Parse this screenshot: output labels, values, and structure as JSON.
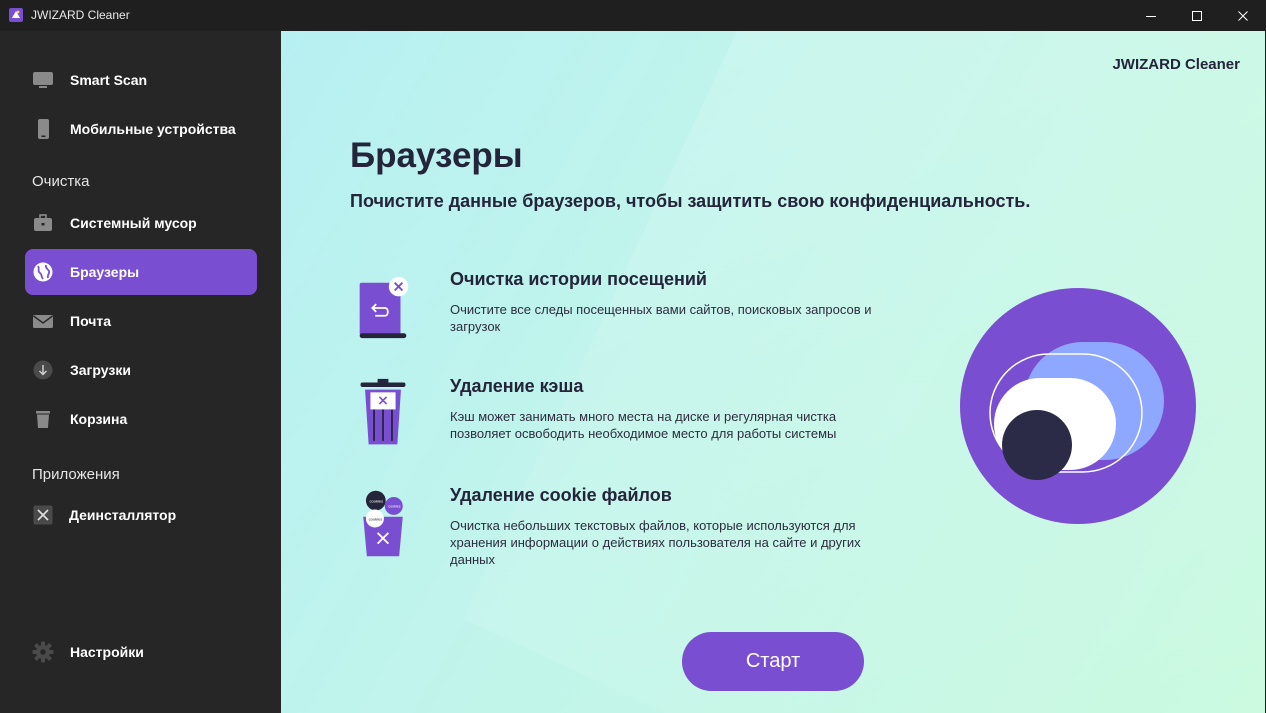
{
  "window": {
    "title": "JWIZARD Cleaner"
  },
  "sidebar": {
    "top_items": [
      {
        "label": "Smart Scan",
        "icon": "monitor-icon"
      },
      {
        "label": "Мобильные устройства",
        "icon": "phone-icon"
      }
    ],
    "section_cleaning": "Очистка",
    "cleaning_items": [
      {
        "label": "Системный мусор",
        "icon": "briefcase-icon"
      },
      {
        "label": "Браузеры",
        "icon": "globe-icon",
        "active": true
      },
      {
        "label": "Почта",
        "icon": "mail-icon"
      },
      {
        "label": "Загрузки",
        "icon": "download-icon"
      },
      {
        "label": "Корзина",
        "icon": "trash-icon"
      }
    ],
    "section_apps": "Приложения",
    "apps_items": [
      {
        "label": "Деинсталлятор",
        "icon": "uninstall-icon"
      }
    ],
    "settings": {
      "label": "Настройки",
      "icon": "gear-icon"
    }
  },
  "main": {
    "brand": "JWIZARD Cleaner",
    "title": "Браузеры",
    "subtitle": "Почистите данные браузеров, чтобы защитить свою конфиденциальность.",
    "features": [
      {
        "title": "Очистка истории посещений",
        "description": "Очистите все следы посещенных вами сайтов, поисковых запросов и загрузок",
        "icon": "history-book-icon"
      },
      {
        "title": "Удаление кэша",
        "description": "Кэш может занимать много места на диске и регулярная чистка позволяет освободить необходимое место для работы системы",
        "icon": "cache-trash-icon"
      },
      {
        "title": "Удаление cookie файлов",
        "description": "Очистка небольших текстовых файлов, которые используются для хранения информации о действиях пользователя на сайте и других данных",
        "icon": "cookie-bin-icon",
        "icon_text": "cookies"
      }
    ],
    "start_label": "Старт"
  },
  "colors": {
    "accent": "#7a4ed0",
    "sidebar_bg": "#262626",
    "text_dark": "#24243a"
  }
}
